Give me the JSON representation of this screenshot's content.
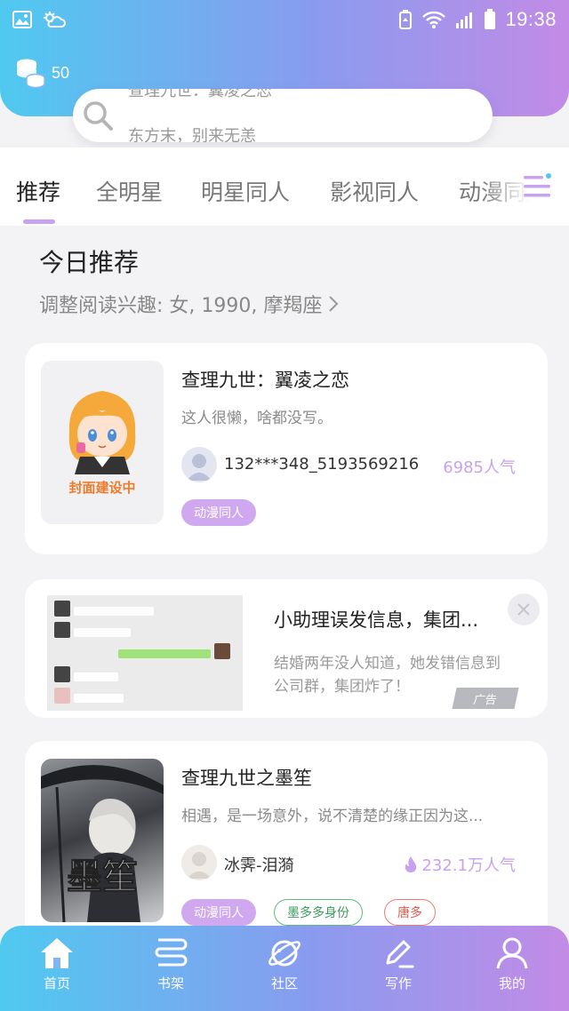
{
  "status_bar": {
    "time": "19:38"
  },
  "header": {
    "coins": "50"
  },
  "search": {
    "rotating_text_top": "查理九世：翼凌之恋",
    "rotating_text_bottom": "东方末，别来无恙"
  },
  "tabs": [
    {
      "label": "推荐",
      "active": true
    },
    {
      "label": "全明星"
    },
    {
      "label": "明星同人"
    },
    {
      "label": "影视同人"
    },
    {
      "label": "动漫同人"
    }
  ],
  "today": {
    "title": "今日推荐",
    "subtitle": "调整阅读兴趣: 女, 1990, 摩羯座"
  },
  "book1": {
    "cover_text": "封面建设中",
    "title": "查理九世：翼凌之恋",
    "desc": "这人很懒，啥都没写。",
    "author": "132***348_5193569216",
    "popularity": "6985人气",
    "tags": [
      "动漫同人"
    ]
  },
  "ad": {
    "title": "小助理误发信息，集团...",
    "desc": "结婚两年没人知道，她发错信息到公司群，集团炸了！",
    "badge": "广告"
  },
  "book2": {
    "title": "查理九世之墨笙",
    "desc": "相遇，是一场意外，说不清楚的缘正因为这...",
    "author": "冰霁-泪漪",
    "popularity": "232.1万人气",
    "cover_text": "墨笙",
    "tags": [
      "动漫同人",
      "墨多多身份",
      "唐多"
    ]
  },
  "bottom_nav": [
    {
      "label": "首页",
      "icon": "home-icon"
    },
    {
      "label": "书架",
      "icon": "bookshelf-icon"
    },
    {
      "label": "社区",
      "icon": "planet-icon"
    },
    {
      "label": "写作",
      "icon": "pen-icon"
    },
    {
      "label": "我的",
      "icon": "user-icon"
    }
  ],
  "colors": {
    "accent": "#c7a2ee",
    "gradient_start": "#4fc9f0",
    "gradient_end": "#c28be6"
  }
}
